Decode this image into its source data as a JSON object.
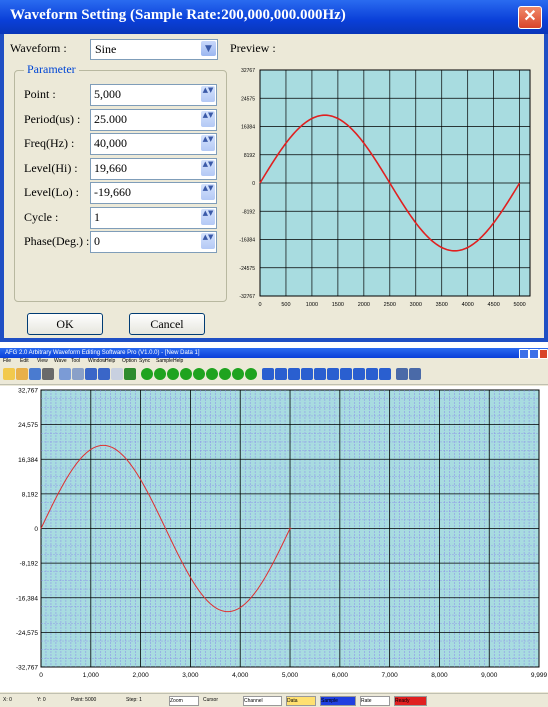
{
  "dialog": {
    "title": "Waveform Setting (Sample Rate:200,000,000.000Hz)",
    "close_glyph": "✕",
    "waveform_label": "Waveform :",
    "waveform_value": "Sine",
    "preview_label": "Preview :",
    "parameter_group": "Parameter",
    "params": [
      {
        "label": "Point :",
        "value": "5,000"
      },
      {
        "label": "Period(us) :",
        "value": "25.000"
      },
      {
        "label": "Freq(Hz) :",
        "value": "40,000"
      },
      {
        "label": "Level(Hi) :",
        "value": "19,660"
      },
      {
        "label": "Level(Lo) :",
        "value": "-19,660"
      },
      {
        "label": "Cycle :",
        "value": "1"
      },
      {
        "label": "Phase(Deg.) :",
        "value": "0"
      }
    ],
    "ok_label": "OK",
    "cancel_label": "Cancel",
    "preview_chart": {
      "type": "line",
      "y_ticks": [
        "32767",
        "24575",
        "16384",
        "8192",
        "0",
        "-8192",
        "-16384",
        "-24575",
        "-32767"
      ],
      "x_ticks": [
        "0",
        "500",
        "1000",
        "1500",
        "2000",
        "2500",
        "3000",
        "3500",
        "4000",
        "4500",
        "5000"
      ],
      "ylim": [
        -32767,
        32767
      ],
      "xlim": [
        0,
        5200
      ],
      "series": [
        {
          "points": 5000,
          "amplitude": 19660,
          "cycles": 1,
          "phase_deg": 0,
          "color": "#e02020"
        }
      ],
      "grid": true,
      "background": "#a8dce0"
    }
  },
  "app": {
    "title": "AFG 2.0 Arbitrary Waveform Editing Software Pro (V1.0.0) - [New Data 1]",
    "menu": [
      "File",
      "Edit",
      "View",
      "Wave",
      "Tool",
      "Window",
      "Help",
      "Option",
      "Sync",
      "Sample",
      "Help"
    ],
    "toolbar_icons": [
      "new-icon",
      "open-icon",
      "save-icon",
      "print-icon",
      "zoom-icon",
      "cut-icon",
      "undo-icon",
      "redo-icon",
      "grid-icon",
      "fit-icon",
      "sine-icon",
      "square-icon",
      "triangle-icon",
      "ramp-icon",
      "noise-icon",
      "pulse-icon",
      "dc-icon",
      "sinc-icon",
      "math-icon",
      "wave-a-icon",
      "wave-b-icon",
      "wave-c-icon",
      "wave-d-icon",
      "wave-e-icon",
      "wave-f-icon",
      "wave-g-icon",
      "wave-h-icon",
      "wave-i-icon",
      "scroll-icon",
      "chart-icon",
      "bars-icon"
    ],
    "chart": {
      "type": "line",
      "y_ticks": [
        "32,767",
        "24,575",
        "16,384",
        "8,192",
        "0",
        "-8,192",
        "-16,384",
        "-24,575",
        "-32,767"
      ],
      "x_ticks": [
        "0",
        "1,000",
        "2,000",
        "3,000",
        "4,000",
        "5,000",
        "6,000",
        "7,000",
        "8,000",
        "9,000",
        "9,999"
      ],
      "ylim": [
        -32767,
        32767
      ],
      "xlim": [
        0,
        9999
      ],
      "series": [
        {
          "points": 5000,
          "amplitude": 19660,
          "cycles": 1,
          "phase_deg": 0,
          "color": "#e03030"
        }
      ],
      "grid": true,
      "background": "#a8dce0"
    },
    "status": [
      "X: 0",
      "Y: 0",
      "Point: 5000",
      "Step: 1",
      "Zoom",
      "Cursor",
      "Channel",
      "Data",
      "Sample",
      "Rate",
      "Ready"
    ]
  }
}
